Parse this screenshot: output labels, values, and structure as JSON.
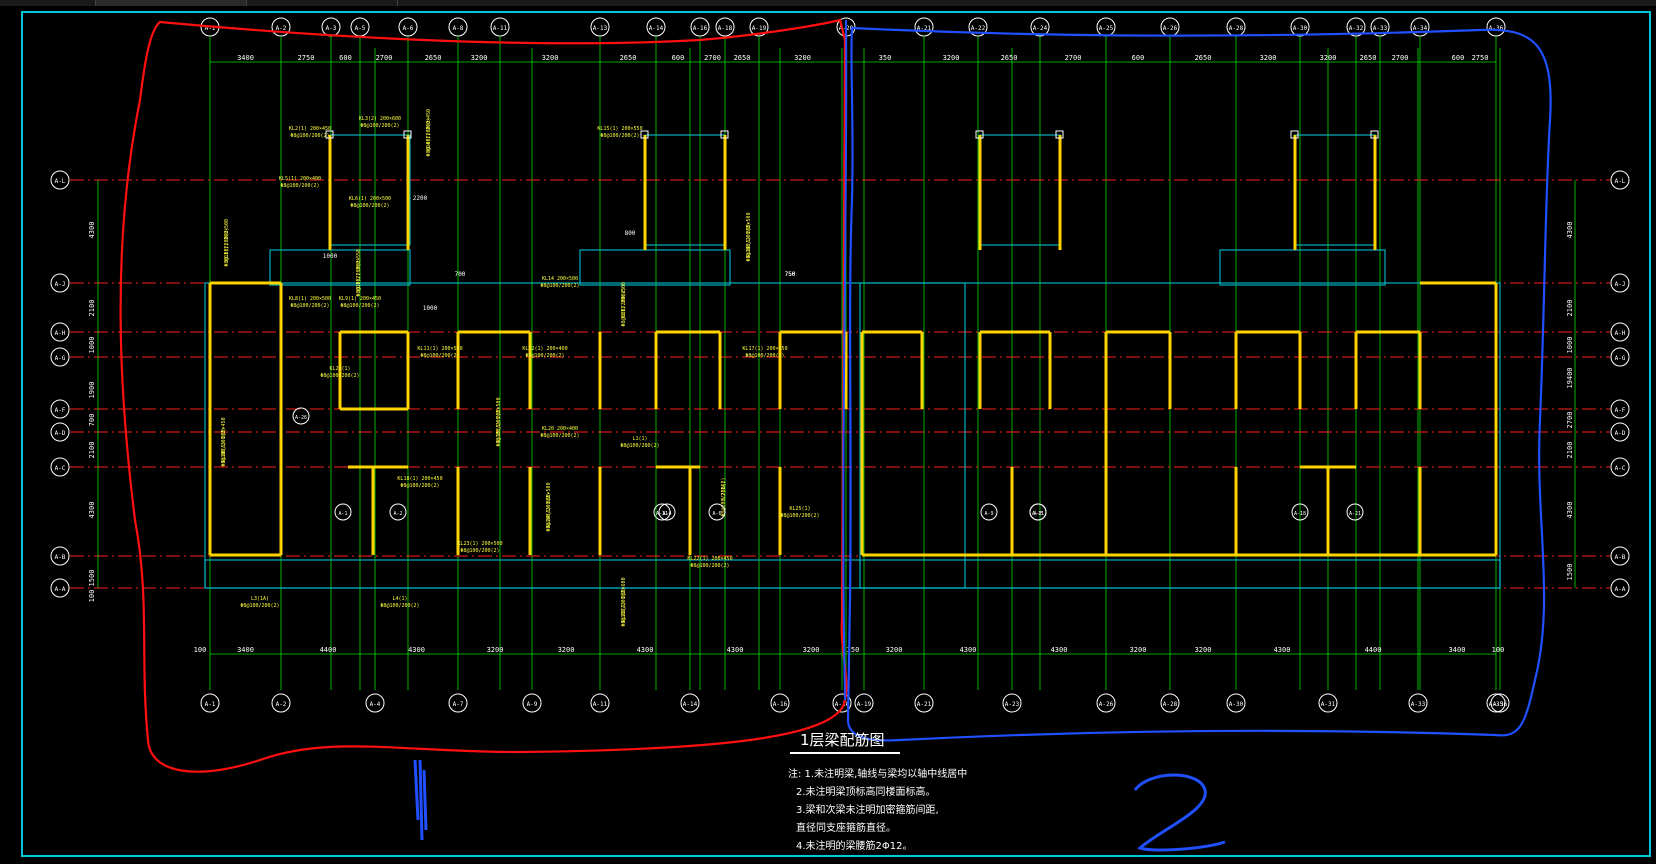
{
  "drawing": {
    "title": "1层梁配筋图",
    "notes": [
      "注: 1.未注明梁,轴线与梁均以轴中线居中",
      "2.未注明梁顶标高同楼面标高。",
      "3.梁和次梁未注明加密箍筋间距,",
      "   直径同支座箍筋直径。",
      "4.未注明的梁腰筋2Φ12。"
    ],
    "top_axes": [
      "A-1",
      "A-2",
      "A-3",
      "A-5",
      "A-6",
      "A-8",
      "A-11",
      "A-13",
      "A-14",
      "A-16",
      "A-18",
      "A-19",
      "A-20",
      "A-21",
      "A-22",
      "A-24",
      "A-25",
      "A-26",
      "A-28",
      "A-30",
      "A-32",
      "A-33",
      "A-34",
      "A-36"
    ],
    "bottom_axes": [
      "A-1",
      "A-2",
      "A-4",
      "A-7",
      "A-9",
      "A-11",
      "A-14",
      "A-16",
      "A-18",
      "A-19",
      "A-21",
      "A-23",
      "A-26",
      "A-28",
      "A-30",
      "A-31",
      "A-33",
      "A-35",
      "A-36"
    ],
    "row_axes": [
      "A-L",
      "A-J",
      "A-H",
      "A-G",
      "A-F",
      "A-D",
      "A-C",
      "A-B",
      "A-A"
    ],
    "top_dims": [
      "3400",
      "2750",
      "600",
      "2700",
      "2650",
      "3200",
      "3200",
      "2650",
      "600",
      "2700",
      "2650",
      "3200",
      "350",
      "3200",
      "2650",
      "2700",
      "600",
      "2650",
      "3200",
      "3200",
      "2650",
      "2700",
      "600",
      "2750",
      "3400"
    ],
    "bottom_dims": [
      "100",
      "3400",
      "4400",
      "4300",
      "3200",
      "3200",
      "4300",
      "4300",
      "3200",
      "350",
      "3200",
      "4300",
      "4300",
      "3200",
      "3200",
      "4300",
      "4400",
      "3400",
      "100"
    ],
    "left_dims": [
      "100",
      "1500",
      "4300",
      "2100",
      "700",
      "1900",
      "1000",
      "2100",
      "4300"
    ],
    "right_dims": [
      "4300",
      "2100",
      "1000",
      "19400",
      "2700",
      "2100",
      "4300",
      "1500"
    ],
    "inner_labels": [
      "A-1",
      "A-2",
      "A-4",
      "A-6",
      "A-9",
      "A-11",
      "A-18",
      "A-21",
      "A-26",
      "A-31",
      "A-E"
    ],
    "beam_labels": [
      "KL1(1) 200×500",
      "KL2(1) 200×450",
      "KL3(2) 200×600",
      "KL4(1) 200×450",
      "KL5(1) 200×400",
      "KL6(1) 200×500",
      "KL7(2) 200×550",
      "KL8(1) 200×500",
      "KL9(1) 200×450",
      "KL10(1) 200×450",
      "KL11(1) 200×550",
      "KL12(1) 200×400",
      "KL13 200×500",
      "KL14 200×500",
      "KL15(1) 200×550",
      "KL16(1) 200×500",
      "KL17(1) 200×450",
      "KL18(1) 200×450",
      "KL19(3) 200×500",
      "KL20 200×400",
      "L1(1)",
      "L2(1A)",
      "L3(1A)",
      "L4(1)",
      "KL21(2) 200×600",
      "KL22(1) 200×450",
      "KL23(1) 200×500",
      "KL24(1) 200×500",
      "KL25(1)",
      "KL26(1)"
    ],
    "small_dims": [
      "700",
      "750",
      "750",
      "1000",
      "2200",
      "800",
      "1000"
    ]
  },
  "colors": {
    "background": "#000000",
    "frame": "#00c8d8",
    "axis_line": "#00e000",
    "axis_bubble": "#ffffff",
    "beam_red": "#ff2020",
    "column": "#ffd400",
    "wall": "#00b0c0",
    "annotation": "#ffff40",
    "markup_red": "#ff1010",
    "markup_blue": "#2050ff"
  },
  "markup": {
    "region_1_label": "1",
    "region_2_label": "2"
  }
}
